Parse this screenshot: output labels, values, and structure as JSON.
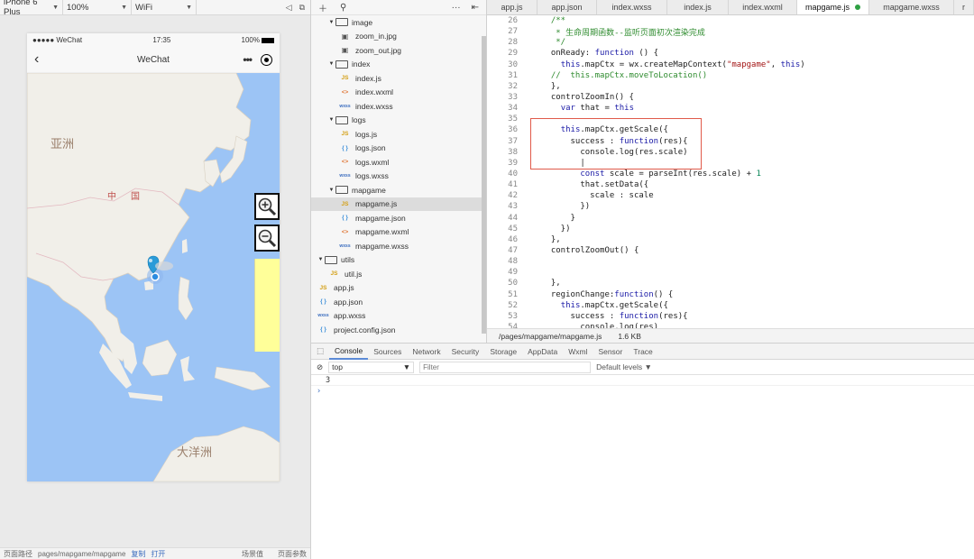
{
  "simulator": {
    "device": "iPhone 6 Plus",
    "zoom": "100%",
    "network": "WiFi",
    "status": {
      "carrier": "●●●●● WeChat",
      "time": "17:35",
      "battery": "100%"
    },
    "nav_title": "WeChat",
    "map_labels": {
      "asia": "亚洲",
      "china_1": "中",
      "china_2": "国",
      "ocean": "大洋洲"
    },
    "footer": {
      "path_label": "页面路径",
      "path": "pages/mapgame/mapgame",
      "copy": "复制",
      "open": "打开",
      "scene": "场景值",
      "params": "页面参数"
    }
  },
  "file_tree": [
    {
      "type": "folder",
      "indent": 1,
      "name": "image"
    },
    {
      "type": "img",
      "indent": 2,
      "name": "zoom_in.jpg"
    },
    {
      "type": "img",
      "indent": 2,
      "name": "zoom_out.jpg"
    },
    {
      "type": "folder",
      "indent": 1,
      "name": "index"
    },
    {
      "type": "js",
      "indent": 2,
      "name": "index.js"
    },
    {
      "type": "wxml",
      "indent": 2,
      "name": "index.wxml"
    },
    {
      "type": "wxss",
      "indent": 2,
      "name": "index.wxss"
    },
    {
      "type": "folder",
      "indent": 1,
      "name": "logs"
    },
    {
      "type": "js",
      "indent": 2,
      "name": "logs.js"
    },
    {
      "type": "json",
      "indent": 2,
      "name": "logs.json"
    },
    {
      "type": "wxml",
      "indent": 2,
      "name": "logs.wxml"
    },
    {
      "type": "wxss",
      "indent": 2,
      "name": "logs.wxss"
    },
    {
      "type": "folder",
      "indent": 1,
      "name": "mapgame"
    },
    {
      "type": "js",
      "indent": 2,
      "name": "mapgame.js",
      "active": true
    },
    {
      "type": "json",
      "indent": 2,
      "name": "mapgame.json"
    },
    {
      "type": "wxml",
      "indent": 2,
      "name": "mapgame.wxml"
    },
    {
      "type": "wxss",
      "indent": 2,
      "name": "mapgame.wxss"
    },
    {
      "type": "folder",
      "indent": 0,
      "name": "utils"
    },
    {
      "type": "js",
      "indent": 1,
      "name": "util.js"
    },
    {
      "type": "js",
      "indent": 0,
      "name": "app.js"
    },
    {
      "type": "json",
      "indent": 0,
      "name": "app.json"
    },
    {
      "type": "wxss",
      "indent": 0,
      "name": "app.wxss"
    },
    {
      "type": "json",
      "indent": 0,
      "name": "project.config.json"
    }
  ],
  "icon_glyphs": {
    "js": "JS",
    "json": "{ }",
    "wxml": "<>",
    "wxss": "wxss",
    "img": "▣"
  },
  "editor": {
    "tabs": [
      "app.js",
      "app.json",
      "index.wxss",
      "index.js",
      "index.wxml",
      "mapgame.js",
      "mapgame.wxss",
      "r"
    ],
    "active_tab": "mapgame.js",
    "lines": [
      {
        "n": "26",
        "t": "  /**",
        "c": "cm"
      },
      {
        "n": "27",
        "t": "   * 生命周期函数--监听页面初次渲染完成",
        "c": "cm"
      },
      {
        "n": "28",
        "t": "   */",
        "c": "cm"
      },
      {
        "n": "29",
        "t": "  onReady: function () {"
      },
      {
        "n": "30",
        "t": "    this.mapCtx = wx.createMapContext(\"mapgame\", this)"
      },
      {
        "n": "31",
        "t": "  //  this.mapCtx.moveToLocation()",
        "c": "cm"
      },
      {
        "n": "32",
        "t": "  },"
      },
      {
        "n": "33",
        "t": "  controlZoomIn() {"
      },
      {
        "n": "34",
        "t": "    var that = this"
      },
      {
        "n": "35",
        "t": ""
      },
      {
        "n": "36",
        "t": "    this.mapCtx.getScale({"
      },
      {
        "n": "37",
        "t": "      success : function(res){"
      },
      {
        "n": "38",
        "t": "        console.log(res.scale)"
      },
      {
        "n": "39",
        "t": "        |"
      },
      {
        "n": "40",
        "t": "        const scale = parseInt(res.scale) + 1"
      },
      {
        "n": "41",
        "t": "        that.setData({"
      },
      {
        "n": "42",
        "t": "          scale : scale"
      },
      {
        "n": "43",
        "t": "        })"
      },
      {
        "n": "44",
        "t": "      }"
      },
      {
        "n": "45",
        "t": "    })"
      },
      {
        "n": "46",
        "t": "  },"
      },
      {
        "n": "47",
        "t": "  controlZoomOut() {"
      },
      {
        "n": "48",
        "t": ""
      },
      {
        "n": "49",
        "t": ""
      },
      {
        "n": "50",
        "t": "  },"
      },
      {
        "n": "51",
        "t": "  regionChange:function() {"
      },
      {
        "n": "52",
        "t": "    this.mapCtx.getScale({"
      },
      {
        "n": "53",
        "t": "      success : function(res){"
      },
      {
        "n": "54",
        "t": "        console.log(res)"
      }
    ],
    "status_path": "/pages/mapgame/mapgame.js",
    "status_size": "1.6 KB"
  },
  "devtools": {
    "tabs": [
      "Console",
      "Sources",
      "Network",
      "Security",
      "Storage",
      "AppData",
      "Wxml",
      "Sensor",
      "Trace"
    ],
    "active_tab": "Console",
    "context": "top",
    "filter_placeholder": "Filter",
    "levels": "Default levels ▼",
    "output": [
      "3"
    ],
    "prompt": "›"
  }
}
